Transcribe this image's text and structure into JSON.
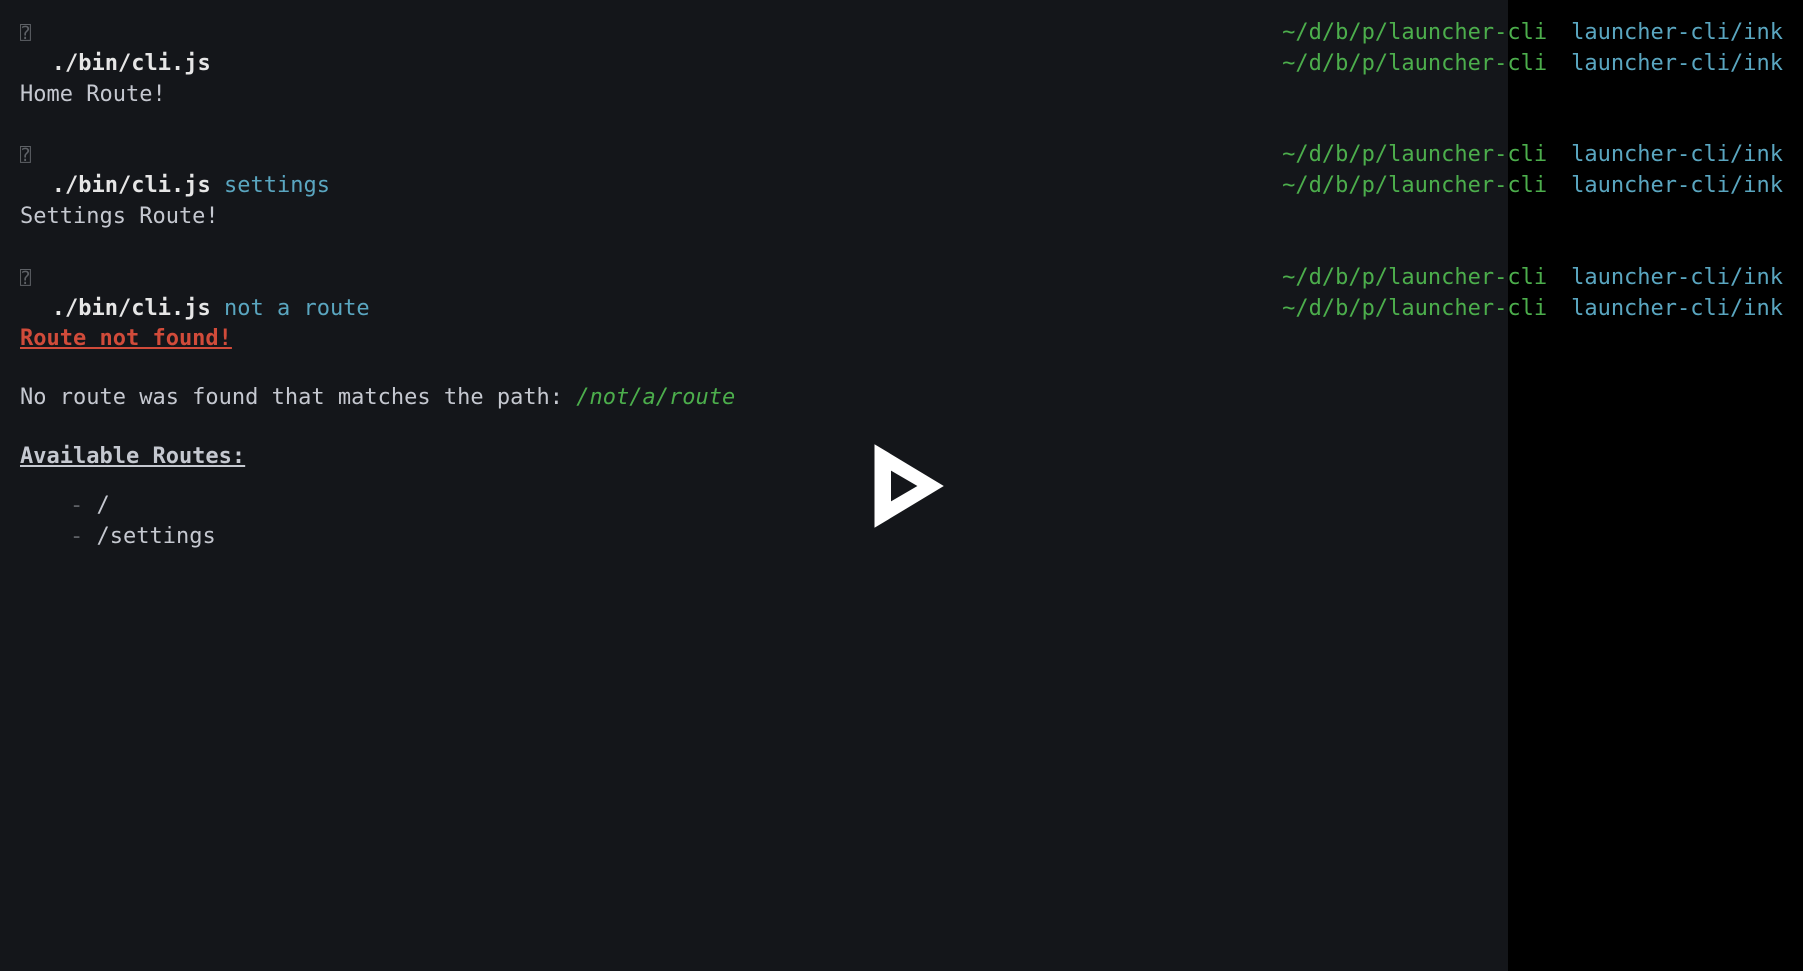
{
  "glyph": "⍰",
  "prompt": {
    "path": "~/d/b/p/launcher-cli",
    "branch": "launcher-cli/ink"
  },
  "blocks": [
    {
      "cmd": "./bin/cli.js",
      "args": "",
      "output": "Home Route!"
    },
    {
      "cmd": "./bin/cli.js",
      "args": "settings",
      "output": "Settings Route!"
    },
    {
      "cmd": "./bin/cli.js",
      "args": "not a route",
      "error": "Route not found!",
      "message_prefix": "No route was found that matches the path: ",
      "message_path": "/not/a/route",
      "routes_title": "Available Routes:",
      "routes": [
        "/",
        "/settings"
      ]
    }
  ]
}
